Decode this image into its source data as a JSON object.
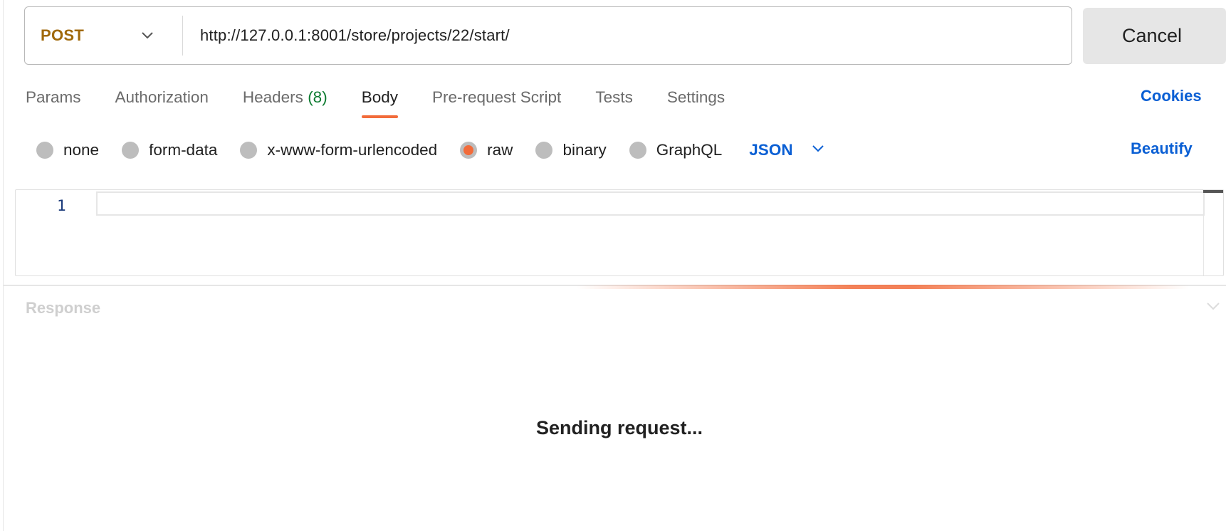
{
  "request": {
    "method": "POST",
    "url": "http://127.0.0.1:8001/store/projects/22/start/",
    "cancel_label": "Cancel"
  },
  "tabs": [
    {
      "label": "Params"
    },
    {
      "label": "Authorization"
    },
    {
      "label": "Headers",
      "count": "(8)"
    },
    {
      "label": "Body",
      "active": true
    },
    {
      "label": "Pre-request Script"
    },
    {
      "label": "Tests"
    },
    {
      "label": "Settings"
    }
  ],
  "cookies_label": "Cookies",
  "body_types": [
    {
      "label": "none"
    },
    {
      "label": "form-data"
    },
    {
      "label": "x-www-form-urlencoded"
    },
    {
      "label": "raw",
      "selected": true
    },
    {
      "label": "binary"
    },
    {
      "label": "GraphQL"
    }
  ],
  "body_language": "JSON",
  "beautify_label": "Beautify",
  "editor": {
    "line_number": "1"
  },
  "response": {
    "label": "Response",
    "status": "Sending request..."
  },
  "colors": {
    "method": "#a0690a",
    "accent": "#f26b3a",
    "link": "#0a5fd4",
    "count": "#0b7a2f"
  }
}
